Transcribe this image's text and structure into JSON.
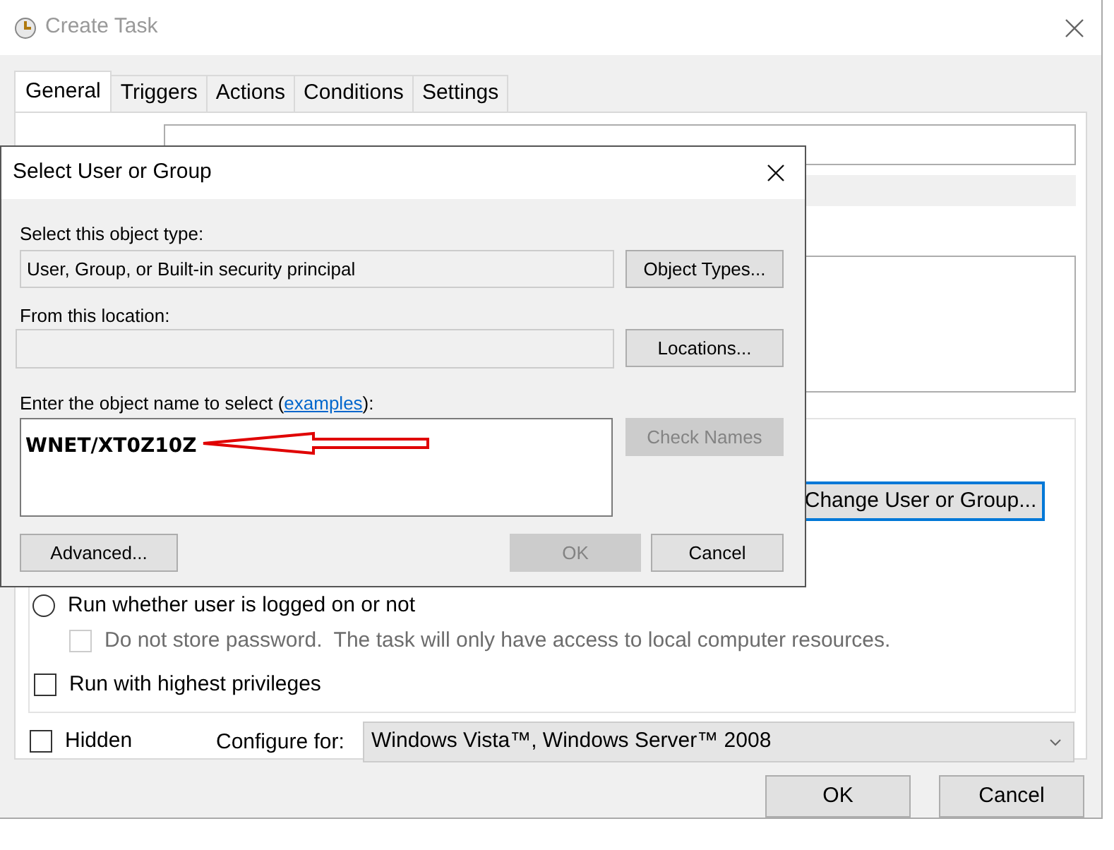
{
  "window": {
    "title": "Create Task"
  },
  "tabs": [
    {
      "label": "General",
      "selected": true
    },
    {
      "label": "Triggers",
      "selected": false
    },
    {
      "label": "Actions",
      "selected": false
    },
    {
      "label": "Conditions",
      "selected": false
    },
    {
      "label": "Settings",
      "selected": false
    }
  ],
  "general": {
    "change_user_button": "Change User or Group...",
    "options": [
      {
        "kind": "radio",
        "label": "Run whether user is logged on or not",
        "selected": false
      },
      {
        "kind": "checkbox",
        "label": "Do not store password.  The task will only have access to local computer resources.",
        "checked": false,
        "disabled": true
      },
      {
        "kind": "checkbox",
        "label": "Run with highest privileges",
        "checked": false,
        "disabled": false
      }
    ],
    "hidden": {
      "label": "Hidden",
      "checked": false
    },
    "configure_label": "Configure for:",
    "configure_value": "Windows Vista™, Windows Server™ 2008"
  },
  "buttons": [
    {
      "label": "OK",
      "disabled": false
    },
    {
      "label": "Cancel",
      "disabled": false
    }
  ],
  "dialog": {
    "title": "Select User or Group",
    "object_type_label": "Select this object type:",
    "object_type_value": "User, Group, or Built-in security principal",
    "object_types_button": "Object Types...",
    "location_label": "From this location:",
    "locations_button": "Locations...",
    "object_name_label": {
      "before": "Enter the object name to select (",
      "link": "examples",
      "after": "):"
    },
    "object_name_value": "WNET/XT0Z10Z",
    "check_names": {
      "label": "Check Names",
      "disabled": true
    },
    "buttons": [
      {
        "label": "Advanced...",
        "disabled": false
      },
      {
        "label": "OK",
        "disabled": true
      },
      {
        "label": "Cancel",
        "disabled": false
      }
    ]
  }
}
